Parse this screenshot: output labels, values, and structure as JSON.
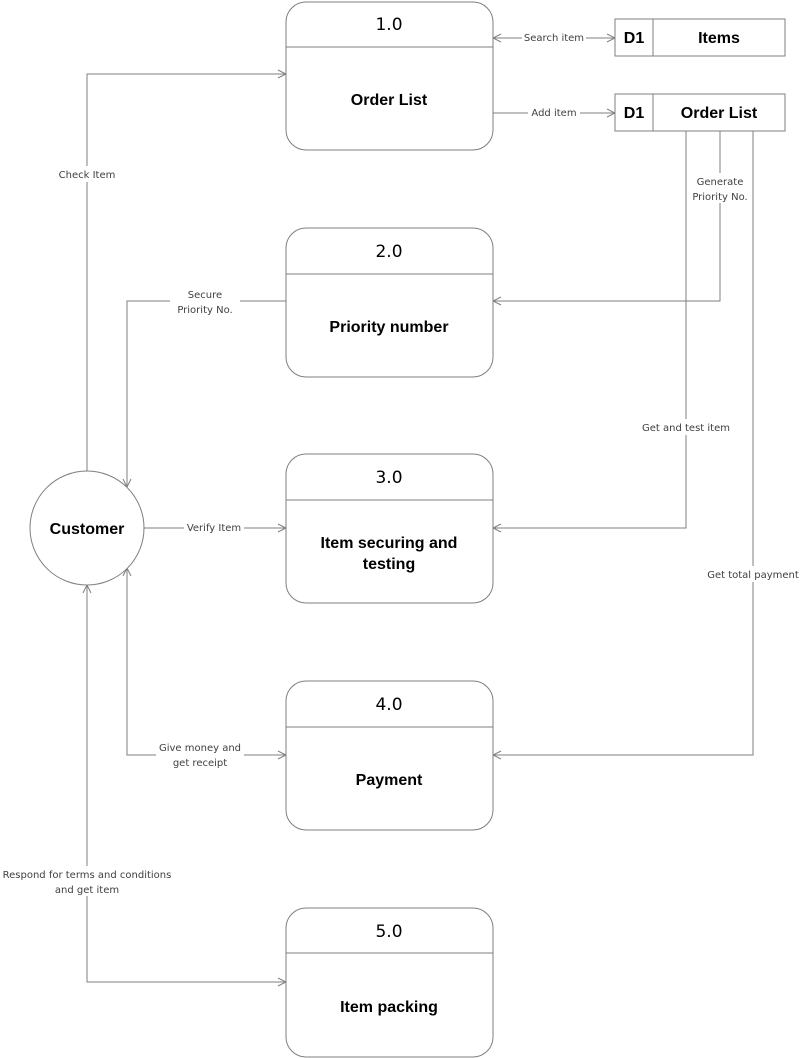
{
  "external_entity": {
    "label": "Customer"
  },
  "processes": [
    {
      "number": "1.0",
      "title": "Order List"
    },
    {
      "number": "2.0",
      "title": "Priority number"
    },
    {
      "number": "3.0",
      "title_line1": "Item securing and",
      "title_line2": "testing"
    },
    {
      "number": "4.0",
      "title": "Payment"
    },
    {
      "number": "5.0",
      "title": "Item packing"
    }
  ],
  "data_stores": [
    {
      "id": "D1",
      "name": "Items"
    },
    {
      "id": "D1",
      "name": "Order List"
    }
  ],
  "flows": {
    "check_item": "Check Item",
    "search_item": "Search item",
    "add_item": "Add item",
    "generate_priority_1": "Generate",
    "generate_priority_2": "Priority No.",
    "secure_priority_1": "Secure",
    "secure_priority_2": "Priority No.",
    "get_and_test": "Get and test item",
    "verify_item": "Verify Item",
    "get_total_payment": "Get total payment",
    "give_money_1": "Give money and",
    "give_money_2": "get receipt",
    "respond_1": "Respond for terms and conditions",
    "respond_2": "and get item"
  }
}
